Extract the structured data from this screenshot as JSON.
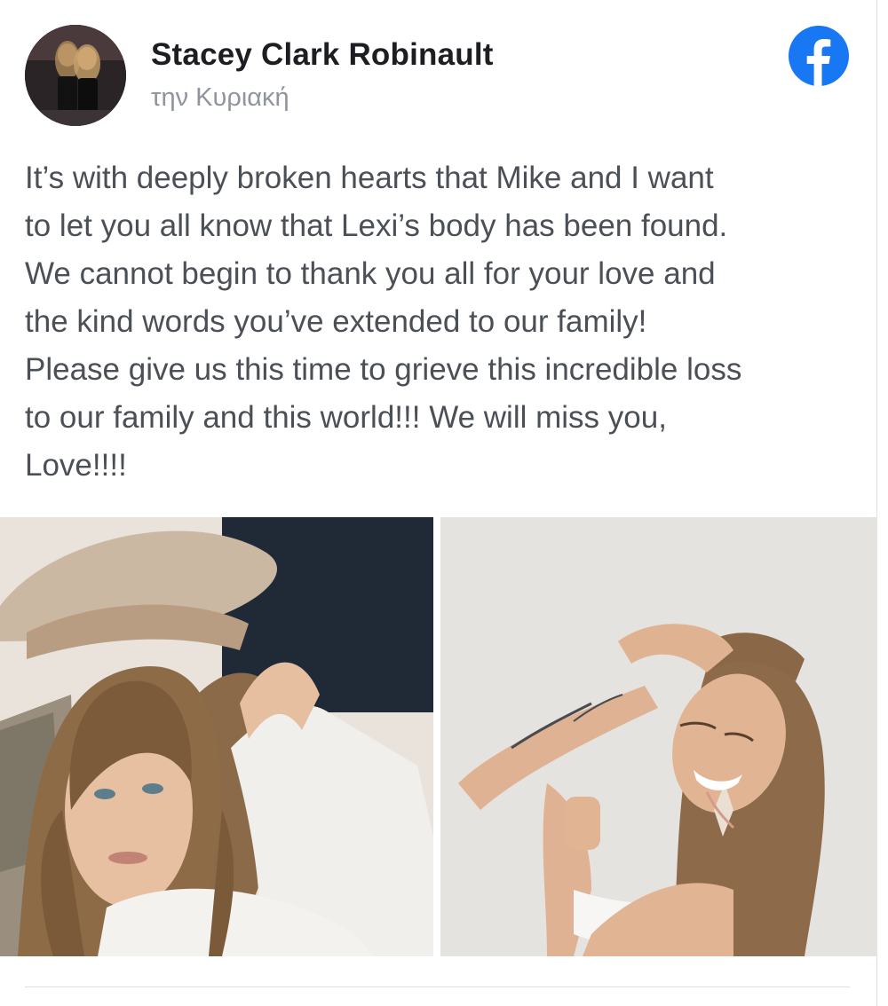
{
  "post": {
    "author": "Stacey Clark Robinault",
    "timestamp": "την Κυριακή",
    "text": "It’s with deeply broken hearts that Mike and I want\nto let you all know that Lexi’s body has been found.\nWe cannot begin to thank you all for your love and\nthe kind words you’ve extended to our family!\nPlease give us this time to grieve this incredible loss\nto our family and this world!!! We will miss you,\nLove!!!!"
  },
  "icons": {
    "platform": "facebook-icon"
  },
  "colors": {
    "facebook_blue": "#1877f2",
    "name_text": "#1c1e21",
    "body_text": "#4b4f56",
    "timestamp_text": "#90949c"
  }
}
